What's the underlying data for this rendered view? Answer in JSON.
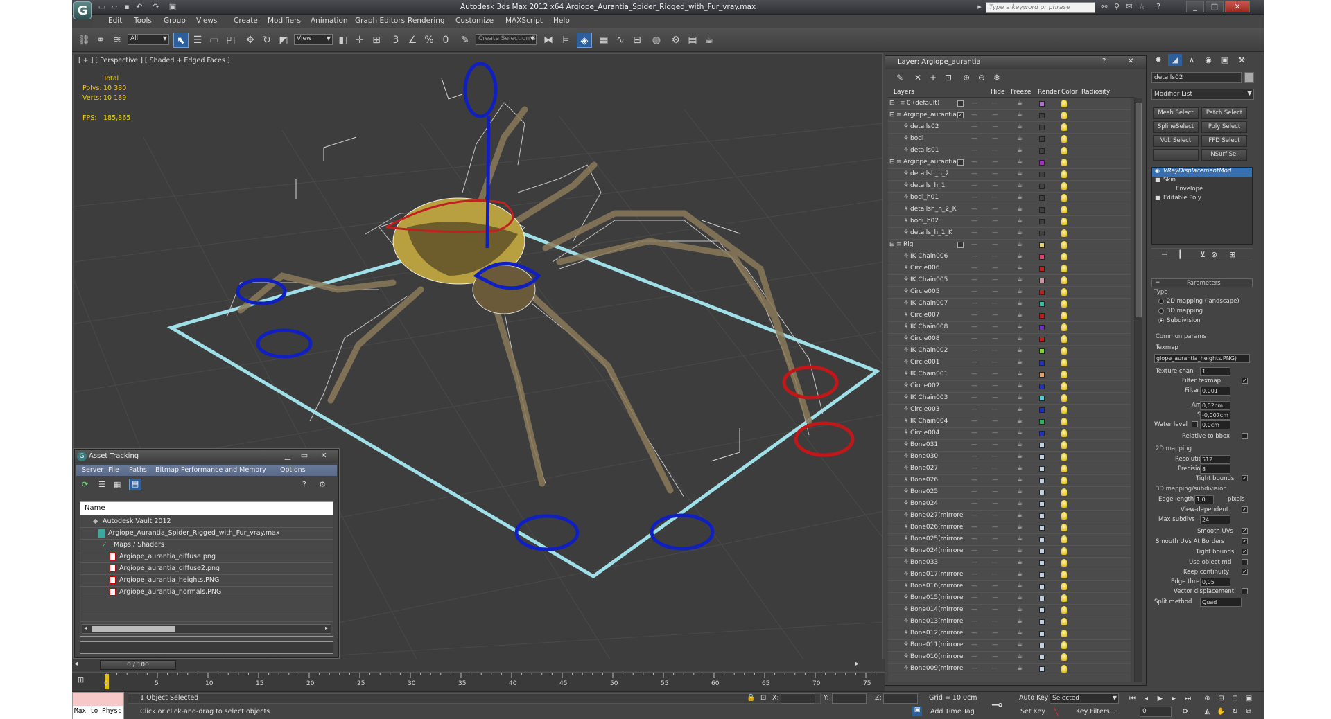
{
  "app": {
    "title": "Autodesk 3ds Max  2012 x64      Argiope_Aurantia_Spider_Rigged_with_Fur_vray.max",
    "logo": "G",
    "search_placeholder": "Type a keyword or phrase",
    "icons": [
      "new-file-icon",
      "open-icon",
      "save-icon",
      "undo-icon",
      "redo-icon",
      "project-icon"
    ]
  },
  "menu": [
    "Edit",
    "Tools",
    "Group",
    "Views",
    "Create",
    "Modifiers",
    "Animation",
    "Graph Editors",
    "Rendering",
    "Customize",
    "MAXScript",
    "Help"
  ],
  "toolbar": {
    "filter_value": "All",
    "coord_value": "View",
    "selection_set_placeholder": "Create Selection Se",
    "snap_labels": {
      "snap": "3",
      "angle": "∠",
      "percent": "%",
      "spinner": "0"
    }
  },
  "viewport": {
    "label": "[ + ] [ Perspective ] [ Shaded + Edged Faces ]",
    "stats": {
      "total_label": "Total",
      "polys_label": "Polys:",
      "polys_value": "10 380",
      "verts_label": "Verts:",
      "verts_value": "10 189",
      "fps_label": "FPS:",
      "fps_value": "185,865"
    }
  },
  "layers": {
    "title": "Layer: Argiope_aurantia",
    "help": "?",
    "close": "✕",
    "columns": [
      "Layers",
      "Hide",
      "Freeze",
      "Render",
      "Color",
      "Radiosity"
    ],
    "rows": [
      {
        "name": "0 (default)",
        "indent": 1,
        "color": "#b070d0",
        "layer": true
      },
      {
        "name": "Argiope_aurantia",
        "indent": 0,
        "color": "#404040",
        "layer": true,
        "active": true
      },
      {
        "name": "details02",
        "indent": 2,
        "color": "#404040"
      },
      {
        "name": "bodi",
        "indent": 2,
        "color": "#404040"
      },
      {
        "name": "details01",
        "indent": 2,
        "color": "#404040"
      },
      {
        "name": "Argiope_aurantia_h",
        "indent": 0,
        "color": "#a030c0",
        "layer": true
      },
      {
        "name": "detailsh_h_2",
        "indent": 2,
        "color": "#404040"
      },
      {
        "name": "details_h_1",
        "indent": 2,
        "color": "#404040"
      },
      {
        "name": "bodi_h01",
        "indent": 2,
        "color": "#404040"
      },
      {
        "name": "detailsh_h_2_K",
        "indent": 2,
        "color": "#404040"
      },
      {
        "name": "bodi_h02",
        "indent": 2,
        "color": "#404040"
      },
      {
        "name": "details_h_1_K",
        "indent": 2,
        "color": "#404040"
      },
      {
        "name": "Rig",
        "indent": 0,
        "color": "#e0d070",
        "layer": true
      },
      {
        "name": "IK Chain006",
        "indent": 2,
        "color": "#e04070"
      },
      {
        "name": "Circle006",
        "indent": 2,
        "color": "#c02020"
      },
      {
        "name": "IK Chain005",
        "indent": 2,
        "color": "#d090a0"
      },
      {
        "name": "Circle005",
        "indent": 2,
        "color": "#c02020"
      },
      {
        "name": "IK Chain007",
        "indent": 2,
        "color": "#30c0a0"
      },
      {
        "name": "Circle007",
        "indent": 2,
        "color": "#c02020"
      },
      {
        "name": "IK Chain008",
        "indent": 2,
        "color": "#7030c0"
      },
      {
        "name": "Circle008",
        "indent": 2,
        "color": "#c02020"
      },
      {
        "name": "IK Chain002",
        "indent": 2,
        "color": "#80d040"
      },
      {
        "name": "Circle001",
        "indent": 2,
        "color": "#2030c0"
      },
      {
        "name": "IK Chain001",
        "indent": 2,
        "color": "#e0a070"
      },
      {
        "name": "Circle002",
        "indent": 2,
        "color": "#2030c0"
      },
      {
        "name": "IK Chain003",
        "indent": 2,
        "color": "#50d0d0"
      },
      {
        "name": "Circle003",
        "indent": 2,
        "color": "#2030c0"
      },
      {
        "name": "IK Chain004",
        "indent": 2,
        "color": "#30b060"
      },
      {
        "name": "Circle004",
        "indent": 2,
        "color": "#2030c0"
      },
      {
        "name": "Bone031",
        "indent": 2,
        "color": "#c0d0e0"
      },
      {
        "name": "Bone030",
        "indent": 2,
        "color": "#c0d0e0"
      },
      {
        "name": "Bone027",
        "indent": 2,
        "color": "#c0d0e0"
      },
      {
        "name": "Bone026",
        "indent": 2,
        "color": "#c0d0e0"
      },
      {
        "name": "Bone025",
        "indent": 2,
        "color": "#c0d0e0"
      },
      {
        "name": "Bone024",
        "indent": 2,
        "color": "#c0d0e0"
      },
      {
        "name": "Bone027(mirrore",
        "indent": 2,
        "color": "#c0d0e0"
      },
      {
        "name": "Bone026(mirrore",
        "indent": 2,
        "color": "#c0d0e0"
      },
      {
        "name": "Bone025(mirrore",
        "indent": 2,
        "color": "#c0d0e0"
      },
      {
        "name": "Bone024(mirrore",
        "indent": 2,
        "color": "#c0d0e0"
      },
      {
        "name": "Bone033",
        "indent": 2,
        "color": "#c0d0e0"
      },
      {
        "name": "Bone017(mirrore",
        "indent": 2,
        "color": "#c0d0e0"
      },
      {
        "name": "Bone016(mirrore",
        "indent": 2,
        "color": "#c0d0e0"
      },
      {
        "name": "Bone015(mirrore",
        "indent": 2,
        "color": "#c0d0e0"
      },
      {
        "name": "Bone014(mirrore",
        "indent": 2,
        "color": "#c0d0e0"
      },
      {
        "name": "Bone013(mirrore",
        "indent": 2,
        "color": "#c0d0e0"
      },
      {
        "name": "Bone012(mirrore",
        "indent": 2,
        "color": "#c0d0e0"
      },
      {
        "name": "Bone011(mirrore",
        "indent": 2,
        "color": "#c0d0e0"
      },
      {
        "name": "Bone010(mirrore",
        "indent": 2,
        "color": "#c0d0e0"
      },
      {
        "name": "Bone009(mirrore",
        "indent": 2,
        "color": "#c0d0e0"
      }
    ]
  },
  "command_panel": {
    "object_name": "details02",
    "modifier_list": "Modifier List",
    "mod_buttons": [
      "Mesh Select",
      "Patch Select",
      "SplineSelect",
      "Poly Select",
      "Vol. Select",
      "FFD Select",
      "",
      "NSurf Sel"
    ],
    "stack": [
      {
        "label": "VRayDisplacementMod",
        "selected": true
      },
      {
        "label": "Skin",
        "selected": false
      },
      {
        "label": "Envelope",
        "selected": false,
        "sub": true
      },
      {
        "label": "Editable Poly",
        "selected": false
      }
    ],
    "params": {
      "rollout": "Parameters",
      "type_label": "Type",
      "type_options": [
        "2D mapping (landscape)",
        "3D mapping",
        "Subdivision"
      ],
      "type_selected": 2,
      "common_params": "Common params",
      "texmap_label": "Texmap",
      "texmap_value": "giope_aurantia_heights.PNG)",
      "texture_chan_label": "Texture chan",
      "texture_chan_value": "1",
      "filter_texmap_label": "Filter texmap",
      "filter_blur_label": "Filter blur",
      "filter_blur_value": "0,001",
      "amount_label": "Amount",
      "amount_value": "0,02cm",
      "shift_label": "Shift",
      "shift_value": "-0,007cm",
      "water_level_label": "Water level",
      "water_level_value": "0,0cm",
      "relative_bbox_label": "Relative to bbox",
      "mapping2d": "2D mapping",
      "resolution_label": "Resolution",
      "resolution_value": "512",
      "precision_label": "Precision",
      "precision_value": "8",
      "tight_bounds_label": "Tight bounds",
      "mapping3d": "3D mapping/subdivision",
      "edge_length_label": "Edge length",
      "edge_length_value": "1,0",
      "pixels_label": "pixels",
      "view_dependent_label": "View-dependent",
      "max_subdivs_label": "Max subdivs",
      "max_subdivs_value": "24",
      "smooth_uvs_label": "Smooth UVs",
      "smooth_uvs_borders_label": "Smooth UVs At Borders",
      "tight_bounds2_label": "Tight bounds",
      "use_object_mtl_label": "Use object mtl",
      "keep_continuity_label": "Keep continuity",
      "edge_thresh_label": "Edge thresh",
      "edge_thresh_value": "0,05",
      "vector_disp_label": "Vector displacement",
      "split_method_label": "Split method",
      "split_method_value": "Quad"
    }
  },
  "asset_tracking": {
    "title": "Asset Tracking",
    "menu": [
      "Server",
      "File",
      "Paths",
      "Bitmap Performance and Memory",
      "Options"
    ],
    "column": "Name",
    "rows": [
      {
        "name": "Autodesk Vault 2012",
        "indent": 1
      },
      {
        "name": "Argiope_Aurantia_Spider_Rigged_with_Fur_vray.max",
        "indent": 2
      },
      {
        "name": "Maps / Shaders",
        "indent": 3
      },
      {
        "name": "Argiope_aurantia_diffuse.png",
        "indent": 4
      },
      {
        "name": "Argiope_aurantia_diffuse2.png",
        "indent": 4
      },
      {
        "name": "Argiope_aurantia_heights.PNG",
        "indent": 4
      },
      {
        "name": "Argiope_aurantia_normals.PNG",
        "indent": 4
      }
    ]
  },
  "timeline": {
    "slider": "0 / 100",
    "ticks": [
      "0",
      "5",
      "10",
      "15",
      "20",
      "25",
      "30",
      "35",
      "40",
      "45",
      "50",
      "55",
      "60",
      "65",
      "70",
      "75"
    ]
  },
  "status": {
    "maxscript": "Max to Physc",
    "selected": "1 Object Selected",
    "prompt": "Click or click-and-drag to select objects",
    "x_label": "X:",
    "y_label": "Y:",
    "z_label": "Z:",
    "grid": "Grid = 10,0cm",
    "add_time_tag": "Add Time Tag",
    "auto_key": "Auto Key",
    "set_key": "Set Key",
    "key_mode": "Selected",
    "key_filters": "Key Filters...",
    "frame": "0"
  }
}
